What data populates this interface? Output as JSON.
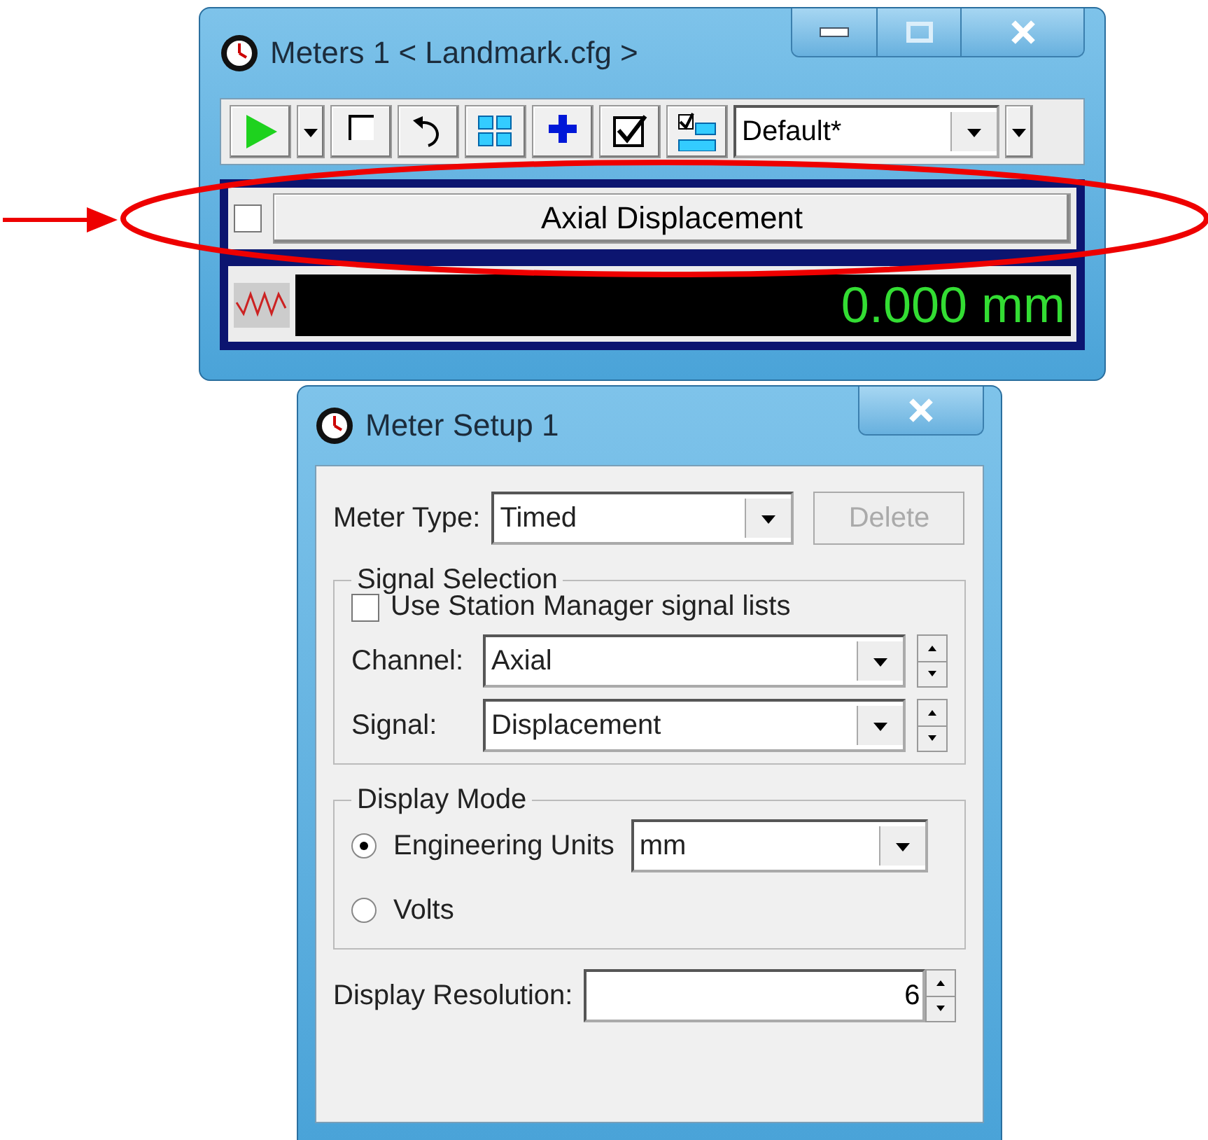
{
  "meters_window": {
    "title": "Meters 1 < Landmark.cfg >",
    "toolbar": [
      {
        "kind": "play"
      },
      {
        "kind": "dropdown"
      },
      {
        "kind": "stop"
      },
      {
        "kind": "undo"
      },
      {
        "kind": "grid"
      },
      {
        "kind": "plus"
      },
      {
        "kind": "check"
      },
      {
        "kind": "checklist"
      }
    ],
    "preset": "Default*",
    "meter": {
      "checked": false,
      "name": "Axial Displacement",
      "reading": "0.000 mm"
    }
  },
  "setup_window": {
    "title": "Meter Setup 1",
    "meter_type": {
      "label": "Meter Type:",
      "value": "Timed"
    },
    "delete_button": {
      "label": "Delete",
      "disabled": true
    },
    "signal_selection": {
      "title": "Signal Selection",
      "use_station_lists": {
        "label": "Use Station Manager signal lists",
        "checked": false
      },
      "channel": {
        "label": "Channel:",
        "value": "Axial"
      },
      "signal": {
        "label": "Signal:",
        "value": "Displacement"
      }
    },
    "display_mode": {
      "title": "Display Mode",
      "options": [
        {
          "label": "Engineering Units",
          "selected": true,
          "units": "mm"
        },
        {
          "label": "Volts",
          "selected": false
        }
      ]
    },
    "display_resolution": {
      "label": "Display Resolution:",
      "value": "6"
    }
  }
}
